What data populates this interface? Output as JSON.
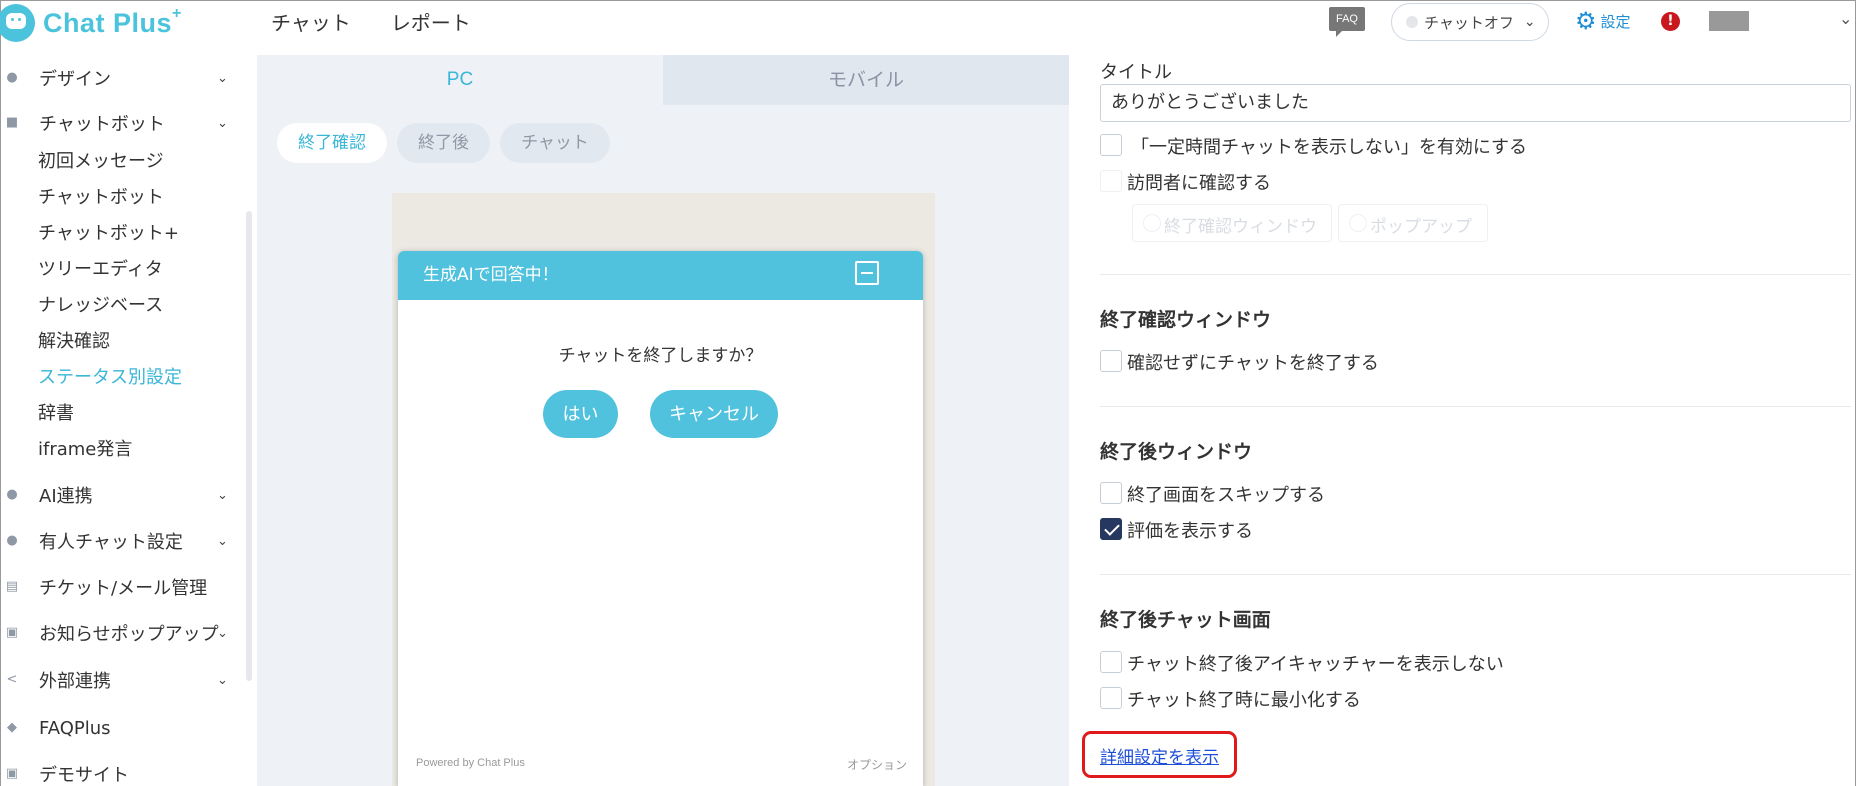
{
  "header": {
    "logo_text": "Chat Plus",
    "logo_sup": "+",
    "nav": [
      "チャット",
      "レポート"
    ],
    "faq": "FAQ",
    "status": "チャットオフ",
    "settings": "設定",
    "alert": "!"
  },
  "sidebar": {
    "design": "デザイン",
    "chatbot": "チャットボット",
    "sub_items": [
      "初回メッセージ",
      "チャットボット",
      "チャットボット+",
      "ツリーエディタ",
      "ナレッジベース",
      "解決確認",
      "ステータス別設定",
      "辞書",
      "iframe発言"
    ],
    "ai": "AI連携",
    "manned": "有人チャット設定",
    "ticket": "チケット/メール管理",
    "popup": "お知らせポップアップ",
    "external": "外部連携",
    "faqplus": "FAQPlus",
    "demo": "デモサイト"
  },
  "preview": {
    "tab_pc": "PC",
    "tab_mobile": "モバイル",
    "subtabs": [
      "終了確認",
      "終了後",
      "チャット"
    ],
    "widget_title": "生成AIで回答中！",
    "question": "チャットを終了しますか？",
    "yes": "はい",
    "cancel": "キャンセル",
    "powered": "Powered by Chat Plus",
    "option": "オプション"
  },
  "settings": {
    "title_label": "タイトル",
    "title_value": "ありがとうございました",
    "hide_chat_option": "「一定時間チャットを表示しない」を有効にする",
    "confirm_visitor": "訪問者に確認する",
    "radio_confirm_window": "終了確認ウィンドウ",
    "radio_popup": "ポップアップ",
    "section_confirm": "終了確認ウィンドウ",
    "end_without_confirm": "確認せずにチャットを終了する",
    "section_after": "終了後ウィンドウ",
    "skip_end_screen": "終了画面をスキップする",
    "show_rating": "評価を表示する",
    "show_rating_checked": true,
    "section_after_chat": "終了後チャット画面",
    "hide_eyecatcher": "チャット終了後アイキャッチャーを表示しない",
    "minimize_on_end": "チャット終了時に最小化する",
    "detail_link": "詳細設定を表示"
  }
}
